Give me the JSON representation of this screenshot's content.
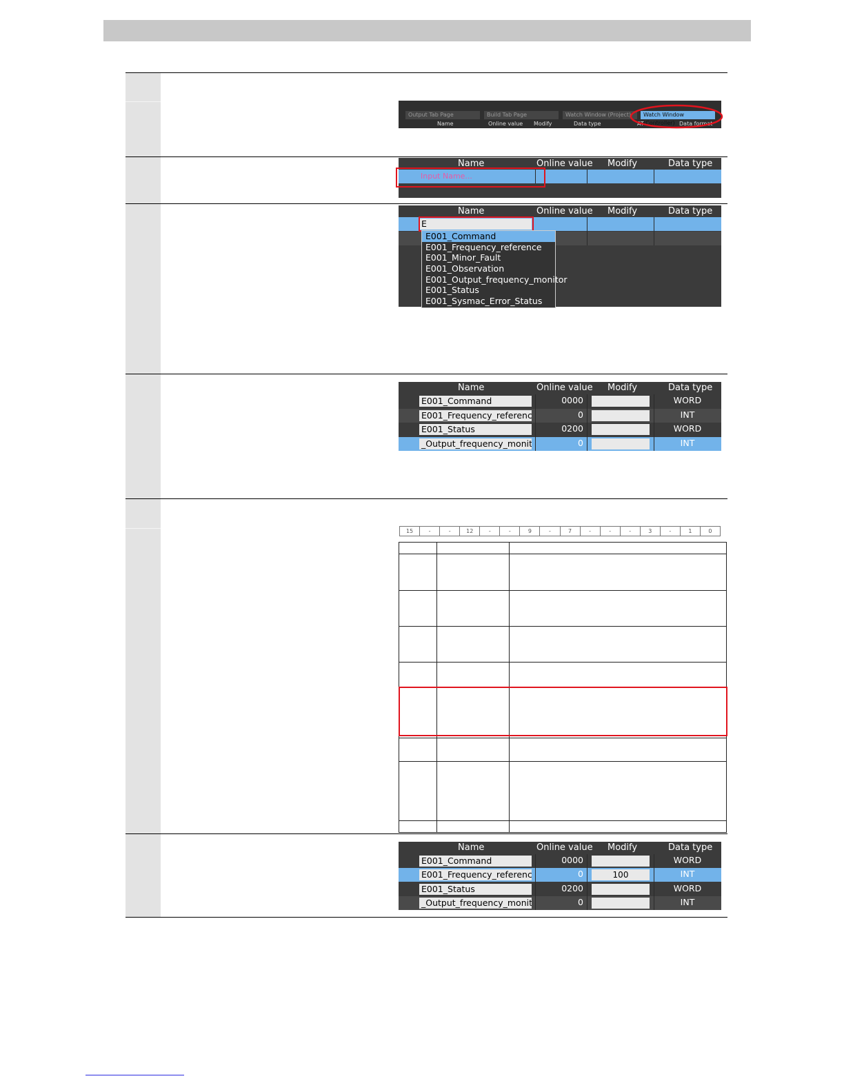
{
  "tabs": {
    "items": [
      "Output Tab Page",
      "Build Tab Page",
      "Watch Window (Project)",
      "Watch Window (Controller)"
    ],
    "headers": [
      "Name",
      "Online value",
      "Modify",
      "Data type",
      "AT",
      "Data format"
    ]
  },
  "grid": {
    "headers": {
      "name": "Name",
      "online_value": "Online value",
      "modify": "Modify",
      "data_type": "Data type"
    },
    "input_placeholder": "Input Name...",
    "typed_text": "E"
  },
  "dropdown": [
    "E001_Command",
    "E001_Frequency_reference",
    "E001_Minor_Fault",
    "E001_Observation",
    "E001_Output_frequency_monitor",
    "E001_Status",
    "E001_Sysmac_Error_Status"
  ],
  "watch1": [
    {
      "name": "E001_Command",
      "value": "0000",
      "modify": "",
      "type": "WORD"
    },
    {
      "name": "E001_Frequency_reference",
      "value": "0",
      "modify": "",
      "type": "INT"
    },
    {
      "name": "E001_Status",
      "value": "0200",
      "modify": "",
      "type": "WORD"
    },
    {
      "name": "_Output_frequency_monitor",
      "value": "0",
      "modify": "",
      "type": "INT"
    }
  ],
  "bit_labels": [
    "15",
    "-",
    "-",
    "12",
    "-",
    "-",
    "9",
    "-",
    "7",
    "-",
    "-",
    "-",
    "3",
    "-",
    "1",
    "0"
  ],
  "watch2": [
    {
      "name": "E001_Command",
      "value": "0000",
      "modify": "",
      "type": "WORD"
    },
    {
      "name": "E001_Frequency_reference",
      "value": "0",
      "modify": "100",
      "type": "INT"
    },
    {
      "name": "E001_Status",
      "value": "0200",
      "modify": "",
      "type": "WORD"
    },
    {
      "name": "_Output_frequency_monitor",
      "value": "0",
      "modify": "",
      "type": "INT"
    }
  ]
}
